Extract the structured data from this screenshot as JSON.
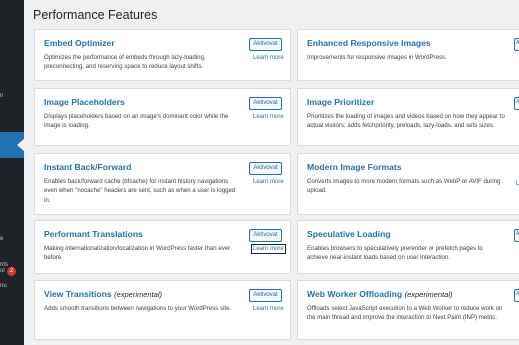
{
  "page": {
    "title": "Performance Features"
  },
  "sidebar": {
    "items": [
      {
        "fragment": "n"
      },
      {
        "fragment": "e"
      },
      {
        "fragment": "nts"
      },
      {
        "fragment": "ol"
      },
      {
        "fragment": "nu"
      }
    ],
    "badge": "2"
  },
  "left_column": [
    {
      "title": "Embed Optimizer",
      "experimental": "",
      "description": "Optimizes the performance of embeds through lazy-loading, preconnecting, and reserving space to reduce layout shifts.",
      "button": "Aktivovat",
      "learn_more": "Learn more"
    },
    {
      "title": "Image Placeholders",
      "experimental": "",
      "description": "Displays placeholders based on an image's dominant color while the image is loading.",
      "button": "Aktivovat",
      "learn_more": "Learn more"
    },
    {
      "title": "Instant Back/Forward",
      "experimental": "",
      "description": "Enables back/forward cache (bfcache) for instant history navigations even when \"nocache\" headers are sent, such as when a user is logged in.",
      "button": "Aktivovat",
      "learn_more": "Learn more"
    },
    {
      "title": "Performant Translations",
      "experimental": "",
      "description": "Making internationalization/localization in WordPress faster than ever before.",
      "button": "Aktivovat",
      "learn_more": "Learn more"
    },
    {
      "title": "View Transitions",
      "experimental": "(experimental)",
      "description": "Adds smooth transitions between navigations to your WordPress site.",
      "button": "Aktivovat",
      "learn_more": "Learn more"
    }
  ],
  "right_column": [
    {
      "title": "Enhanced Responsive Images",
      "experimental": "",
      "description": "Improvements for responsive images in WordPress.",
      "edge": "A"
    },
    {
      "title": "Image Prioritizer",
      "experimental": "",
      "description": "Prioritizes the loading of images and videos based on how they appear to actual visitors: adds fetchpriority, preloads, lazy-loads, and sets sizes.",
      "edge": "A"
    },
    {
      "title": "Modern Image Formats",
      "experimental": "",
      "description": "Converts images to more modern formats such as WebP or AVIF during upload.",
      "edge": "L"
    },
    {
      "title": "Speculative Loading",
      "experimental": "",
      "description": "Enables browsers to speculatively prerender or prefetch pages to achieve near-instant loads based on user interaction.",
      "edge": "A"
    },
    {
      "title": "Web Worker Offloading",
      "experimental": "(experimental)",
      "description": "Offloads select JavaScript execution to a Web Worker to reduce work on the main thread and improve the interaction to Next Paint (INP) metric.",
      "edge": "A"
    }
  ],
  "colors": {
    "accent": "#2271b1",
    "sidebar_bg": "#1d2327",
    "page_bg": "#f0f0f1",
    "badge": "#d63638"
  }
}
